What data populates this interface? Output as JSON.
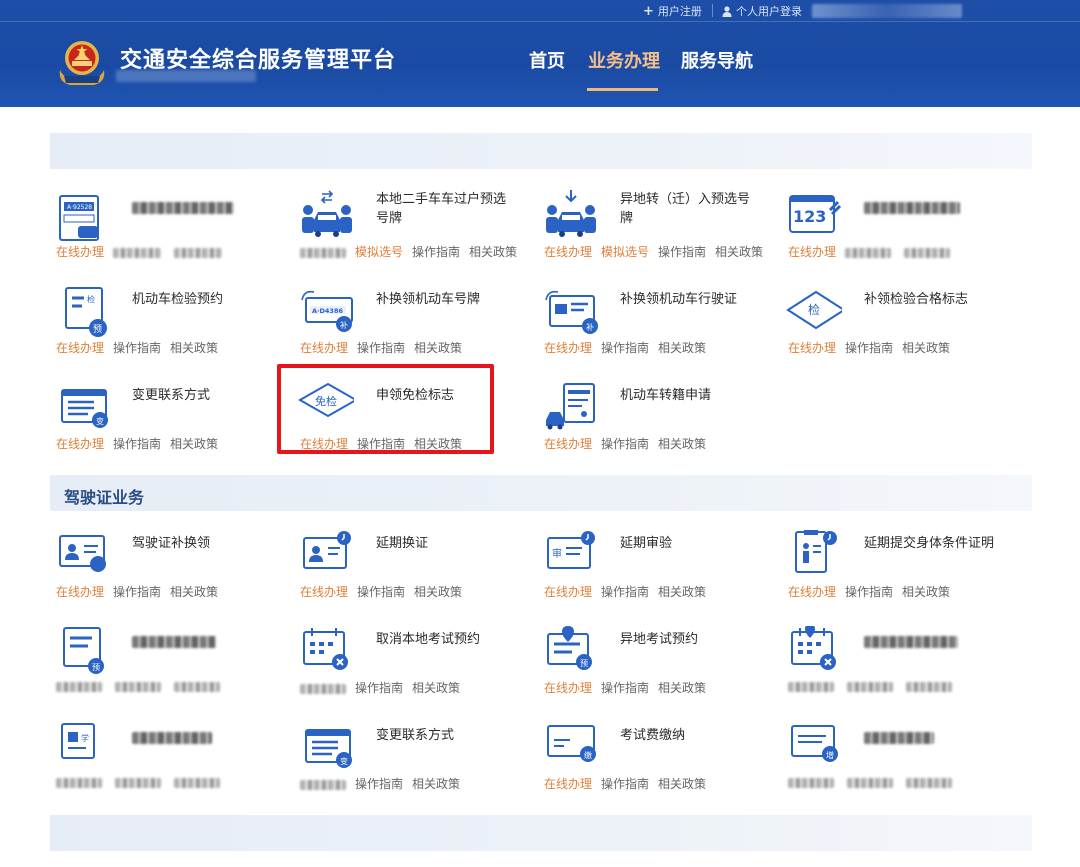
{
  "topbar": {
    "register": "用户注册",
    "login": "个人用户登录"
  },
  "header": {
    "title": "交通安全综合服务管理平台",
    "nav": [
      "首页",
      "业务办理",
      "服务导航"
    ]
  },
  "colors": {
    "header_bg": "#1a4aa3",
    "nav_active": "#f3c089",
    "online_link": "#e0803a",
    "highlight": "#e8141b",
    "section_title": "#2a4d86"
  },
  "links": {
    "online": "在线办理",
    "online_sim": "模拟选号",
    "guide": "操作指南",
    "policy": "相关政策"
  },
  "vehicle_section": {
    "items": [
      {
        "name": "",
        "icon": "plate-doc-icon"
      },
      {
        "name": "本地二手车车过户预选号牌",
        "icon": "car-transfer-icon"
      },
      {
        "name": "异地转（迁）入预选号牌",
        "icon": "car-import-icon"
      },
      {
        "name": "",
        "icon": "number-plate-123-icon"
      },
      {
        "name": "机动车检验预约",
        "icon": "inspection-appointment-icon"
      },
      {
        "name": "补换领机动车号牌",
        "icon": "plate-replace-icon"
      },
      {
        "name": "补换领机动车行驶证",
        "icon": "license-replace-icon"
      },
      {
        "name": "补领检验合格标志",
        "icon": "inspection-mark-icon"
      },
      {
        "name": "变更联系方式",
        "icon": "contact-change-icon"
      },
      {
        "name": "申领免检标志",
        "icon": "exempt-mark-icon"
      },
      {
        "name": "机动车转籍申请",
        "icon": "vehicle-transfer-icon"
      }
    ]
  },
  "driver_section": {
    "title": "驾驶证业务",
    "items": [
      {
        "name": "驾驶证补换领",
        "icon": "driver-license-icon"
      },
      {
        "name": "延期换证",
        "icon": "delay-renew-icon"
      },
      {
        "name": "延期审验",
        "icon": "delay-review-icon"
      },
      {
        "name": "延期提交身体条件证明",
        "icon": "health-cert-icon"
      },
      {
        "name": "",
        "icon": "exam-book-icon"
      },
      {
        "name": "取消本地考试预约",
        "icon": "cancel-exam-icon"
      },
      {
        "name": "异地考试预约",
        "icon": "remote-exam-icon"
      },
      {
        "name": "",
        "icon": "exam-calendar-icon"
      },
      {
        "name": "",
        "icon": "learner-icon"
      },
      {
        "name": "变更联系方式",
        "icon": "contact-change-icon"
      },
      {
        "name": "考试费缴纳",
        "icon": "exam-fee-icon"
      },
      {
        "name": "",
        "icon": "add-class-icon"
      }
    ]
  }
}
